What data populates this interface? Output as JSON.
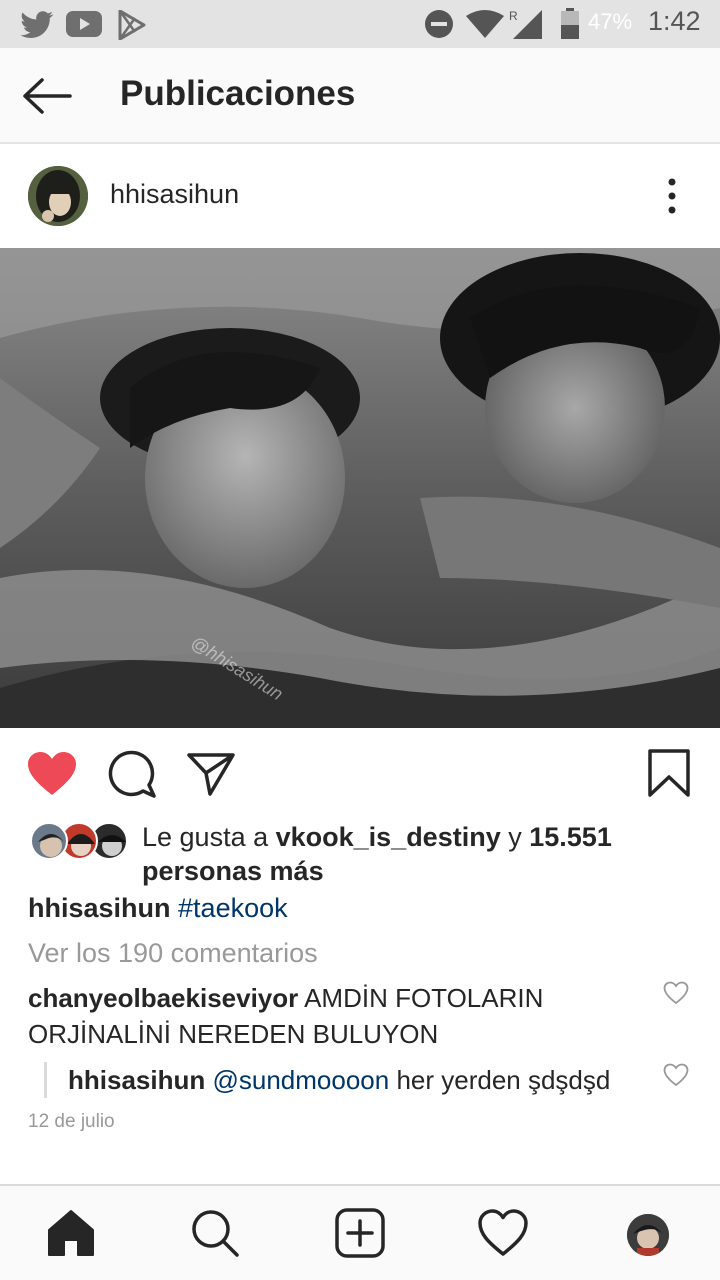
{
  "status_bar": {
    "battery": "47%",
    "time": "1:42",
    "left_icons": [
      "twitter-icon",
      "youtube-icon",
      "play-store-icon"
    ],
    "right_icons": [
      "do-not-disturb-icon",
      "wifi-icon",
      "signal-icon",
      "battery-icon"
    ]
  },
  "header": {
    "title": "Publicaciones"
  },
  "post": {
    "username": "hhisasihun",
    "image_watermark": "@hhisasihun",
    "liked": true,
    "likes": {
      "prefix": "Le gusta a ",
      "user": "vkook_is_destiny",
      "joiner": " y ",
      "count": "15.551",
      "suffix": "personas más"
    },
    "caption": {
      "username": "hhisasihun",
      "hashtag": "#taekook"
    },
    "view_comments": "Ver los 190 comentarios",
    "comments": [
      {
        "username": "chanyeolbaekiseviyor",
        "text": "AMDİN FOTOLARIN ORJİNALİNİ NEREDEN BULUYON"
      }
    ],
    "reply": {
      "username": "hhisasihun",
      "mention": "@sundmoooon",
      "text": "her yerden şdşdşd"
    },
    "date": "12 de julio"
  },
  "colors": {
    "like_red": "#ed4956",
    "link_blue": "#003569",
    "muted_gray": "#999999",
    "status_bar_bg": "#e3e3e3"
  }
}
